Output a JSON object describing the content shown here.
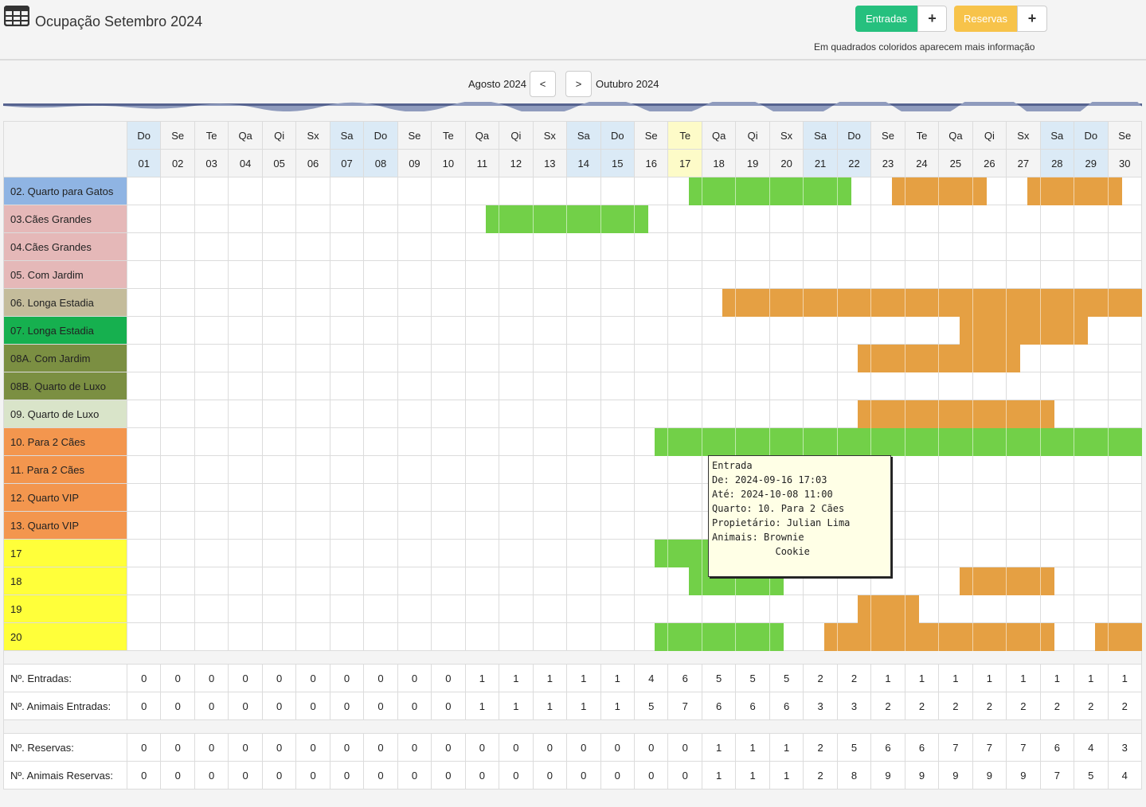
{
  "header": {
    "title": "Ocupação Setembro 2024",
    "entradas_label": "Entradas",
    "entradas_add": "+",
    "reservas_label": "Reservas",
    "reservas_add": "+",
    "hint": "Em quadrados coloridos aparecem mais informação"
  },
  "nav": {
    "prev_label": "Agosto 2024",
    "prev_button": "<",
    "next_button": ">",
    "next_label": "Outubro 2024"
  },
  "colors": {
    "entrada": "#72d048",
    "reserva": "#e5a043",
    "weekend": "#dbeaf6",
    "today": "#fdfbc8"
  },
  "calendar": {
    "weekdays": [
      "Do",
      "Se",
      "Te",
      "Qa",
      "Qi",
      "Sx",
      "Sa",
      "Do",
      "Se",
      "Te",
      "Qa",
      "Qi",
      "Sx",
      "Sa",
      "Do",
      "Se",
      "Te",
      "Qa",
      "Qi",
      "Sx",
      "Sa",
      "Do",
      "Se",
      "Te",
      "Qa",
      "Qi",
      "Sx",
      "Sa",
      "Do",
      "Se"
    ],
    "days": [
      "01",
      "02",
      "03",
      "04",
      "05",
      "06",
      "07",
      "08",
      "09",
      "10",
      "11",
      "12",
      "13",
      "14",
      "15",
      "16",
      "17",
      "18",
      "19",
      "20",
      "21",
      "22",
      "23",
      "24",
      "25",
      "26",
      "27",
      "28",
      "29",
      "30"
    ],
    "weekend_days": [
      1,
      7,
      8,
      14,
      15,
      21,
      22,
      28,
      29
    ],
    "today": 17,
    "rooms": [
      {
        "name": "02. Quarto para Gatos",
        "color": "#8fb4e3",
        "bars": [
          {
            "type": "entrada",
            "from": 17.6,
            "to": 22.4
          },
          {
            "type": "reserva",
            "from": 23.6,
            "to": 26.4
          },
          {
            "type": "reserva",
            "from": 27.6,
            "to": 30.4
          }
        ]
      },
      {
        "name": "03.Cães Grandes",
        "color": "#e5b8b8",
        "bars": [
          {
            "type": "entrada",
            "from": 11.6,
            "to": 16.4
          }
        ]
      },
      {
        "name": "04.Cães Grandes",
        "color": "#e5b8b8",
        "bars": []
      },
      {
        "name": "05. Com Jardim",
        "color": "#e5b8b8",
        "bars": []
      },
      {
        "name": "06. Longa Estadia",
        "color": "#c4bc9b",
        "bars": [
          {
            "type": "reserva",
            "from": 18.6,
            "to": 31
          }
        ]
      },
      {
        "name": "07. Longa Estadia",
        "color": "#16b04f",
        "bars": [
          {
            "type": "reserva",
            "from": 25.6,
            "to": 29.4
          }
        ]
      },
      {
        "name": "08A. Com Jardim",
        "color": "#7b8f42",
        "bars": [
          {
            "type": "reserva",
            "from": 22.6,
            "to": 27.4
          }
        ]
      },
      {
        "name": "08B. Quarto de Luxo",
        "color": "#7b8f42",
        "bars": []
      },
      {
        "name": "09. Quarto de Luxo",
        "color": "#d9e4c9",
        "bars": [
          {
            "type": "reserva",
            "from": 22.6,
            "to": 28.4
          }
        ]
      },
      {
        "name": "10. Para 2 Cães",
        "color": "#f3964e",
        "bars": [
          {
            "type": "entrada",
            "from": 16.6,
            "to": 31
          }
        ]
      },
      {
        "name": "11. Para 2 Cães",
        "color": "#f3964e",
        "bars": []
      },
      {
        "name": "12. Quarto VIP",
        "color": "#f3964e",
        "bars": []
      },
      {
        "name": "13. Quarto VIP",
        "color": "#f3964e",
        "bars": []
      },
      {
        "name": "17",
        "color": "#ffff3a",
        "bars": [
          {
            "type": "entrada",
            "from": 16.6,
            "to": 18.2
          }
        ]
      },
      {
        "name": "18",
        "color": "#ffff3a",
        "bars": [
          {
            "type": "entrada",
            "from": 17.6,
            "to": 20.4
          },
          {
            "type": "reserva",
            "from": 25.6,
            "to": 28.4
          }
        ]
      },
      {
        "name": "19",
        "color": "#ffff3a",
        "bars": [
          {
            "type": "reserva",
            "from": 22.6,
            "to": 24.4
          }
        ]
      },
      {
        "name": "20",
        "color": "#ffff3a",
        "bars": [
          {
            "type": "entrada",
            "from": 16.6,
            "to": 20.4
          },
          {
            "type": "reserva",
            "from": 21.6,
            "to": 28.4
          },
          {
            "type": "reserva",
            "from": 29.6,
            "to": 31
          }
        ]
      }
    ],
    "summary_entradas": [
      {
        "label": "Nº. Entradas:",
        "values": [
          0,
          0,
          0,
          0,
          0,
          0,
          0,
          0,
          0,
          0,
          1,
          1,
          1,
          1,
          1,
          4,
          6,
          5,
          5,
          5,
          2,
          2,
          1,
          1,
          1,
          1,
          1,
          1,
          1,
          1
        ]
      },
      {
        "label": "Nº. Animais Entradas:",
        "values": [
          0,
          0,
          0,
          0,
          0,
          0,
          0,
          0,
          0,
          0,
          1,
          1,
          1,
          1,
          1,
          5,
          7,
          6,
          6,
          6,
          3,
          3,
          2,
          2,
          2,
          2,
          2,
          2,
          2,
          2
        ]
      }
    ],
    "summary_reservas": [
      {
        "label": "Nº. Reservas:",
        "values": [
          0,
          0,
          0,
          0,
          0,
          0,
          0,
          0,
          0,
          0,
          0,
          0,
          0,
          0,
          0,
          0,
          0,
          1,
          1,
          1,
          2,
          5,
          6,
          6,
          7,
          7,
          7,
          6,
          4,
          3
        ]
      },
      {
        "label": "Nº. Animais Reservas:",
        "values": [
          0,
          0,
          0,
          0,
          0,
          0,
          0,
          0,
          0,
          0,
          0,
          0,
          0,
          0,
          0,
          0,
          0,
          1,
          1,
          1,
          2,
          8,
          9,
          9,
          9,
          9,
          9,
          7,
          5,
          4
        ]
      }
    ]
  },
  "tooltip": {
    "text": "Entrada\nDe: 2024-09-16 17:03\nAté: 2024-10-08 11:00\nQuarto: 10. Para 2 Cães\nPropietário: Julian Lima\nAnimais: Brownie\n           Cookie"
  }
}
